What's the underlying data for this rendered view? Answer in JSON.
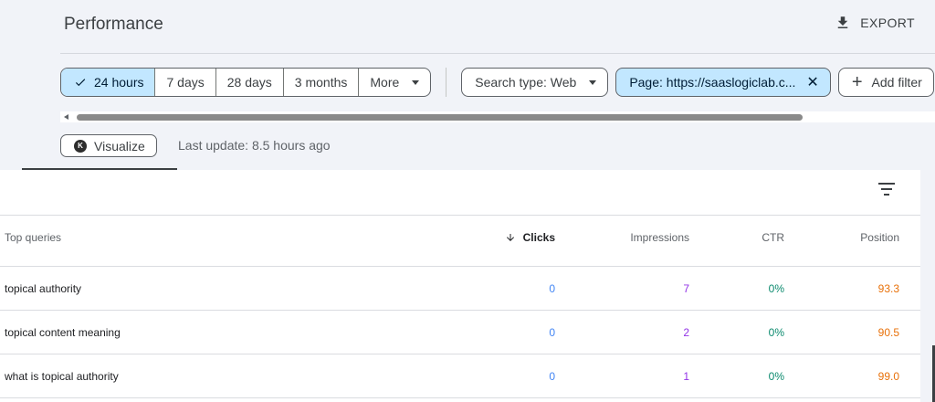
{
  "header": {
    "title": "Performance",
    "export_label": "EXPORT"
  },
  "date_range": {
    "options": [
      "24 hours",
      "7 days",
      "28 days",
      "3 months",
      "More"
    ],
    "selected": "24 hours"
  },
  "filters": {
    "search_type": "Search type: Web",
    "page_filter": "Page: https://saaslogiclab.c...",
    "add_filter": "Add filter"
  },
  "visualize_label": "Visualize",
  "last_update": "Last update: 8.5 hours ago",
  "table": {
    "headers": {
      "query": "Top queries",
      "clicks": "Clicks",
      "impressions": "Impressions",
      "ctr": "CTR",
      "position": "Position"
    },
    "rows": [
      {
        "query": "topical authority",
        "clicks": "0",
        "impressions": "7",
        "ctr": "0%",
        "position": "93.3"
      },
      {
        "query": "topical content meaning",
        "clicks": "0",
        "impressions": "2",
        "ctr": "0%",
        "position": "90.5"
      },
      {
        "query": "what is topical authority",
        "clicks": "0",
        "impressions": "1",
        "ctr": "0%",
        "position": "99.0"
      }
    ]
  },
  "colors": {
    "clicks": "#4285f4",
    "impressions": "#9334e6",
    "ctr": "#0b8a6e",
    "position": "#e8710a",
    "active_chip": "#c2e7ff"
  },
  "icons": {
    "export": "download-icon",
    "check": "check-icon",
    "sort": "arrow-down-icon",
    "close": "close-icon",
    "add": "plus-icon",
    "table_filter": "filter-list-icon"
  }
}
